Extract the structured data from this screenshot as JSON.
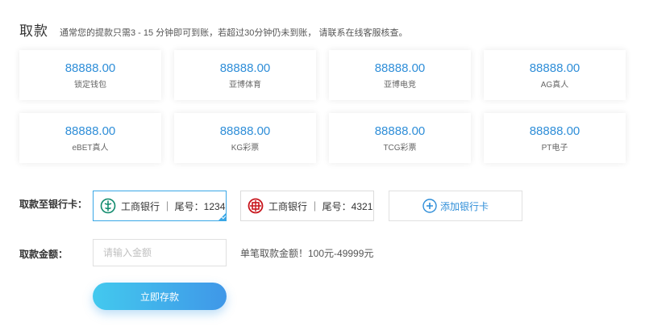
{
  "header": {
    "title": "取款",
    "notice": "通常您的提款只需3 - 15 分钟即可到账，若超过30分钟仍未到账， 请联系在线客服核查。"
  },
  "wallets": [
    {
      "amount": "88888.00",
      "name": "锁定钱包"
    },
    {
      "amount": "88888.00",
      "name": "亚博体育"
    },
    {
      "amount": "88888.00",
      "name": "亚博电竞"
    },
    {
      "amount": "88888.00",
      "name": "AG真人"
    },
    {
      "amount": "88888.00",
      "name": "eBET真人"
    },
    {
      "amount": "88888.00",
      "name": "KG彩票"
    },
    {
      "amount": "88888.00",
      "name": "TCG彩票"
    },
    {
      "amount": "88888.00",
      "name": "PT电子"
    }
  ],
  "bank_section": {
    "label": "取款至银行卡：",
    "cards": [
      {
        "text": "工商银行 ｜ 尾号：1234",
        "logo": "abc-bank-logo",
        "selected": true
      },
      {
        "text": "工商银行 ｜ 尾号：4321",
        "logo": "icbc-bank-logo",
        "selected": false
      }
    ],
    "add_label": "添加银行卡"
  },
  "amount_section": {
    "label": "取款金额：",
    "placeholder": "请输入金额",
    "value": "",
    "hint": "单笔取款金额！100元-49999元"
  },
  "submit": {
    "label": "立即存款"
  },
  "colors": {
    "accent": "#2f8ed8",
    "selected_border": "#3aa7e6",
    "button_gradient_start": "#43c9ee",
    "button_gradient_end": "#3f97e8",
    "abc_green": "#0f8a6c",
    "icbc_red": "#c8161d"
  }
}
